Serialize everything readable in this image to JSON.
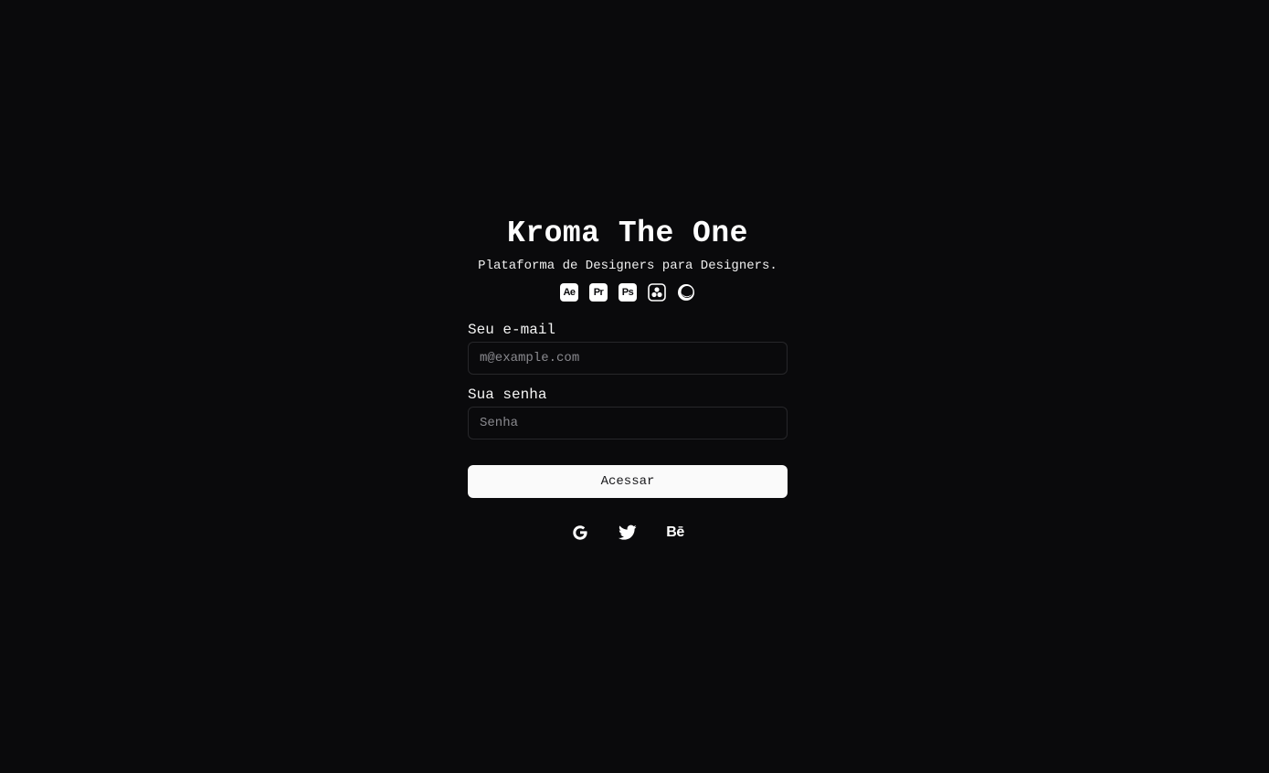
{
  "header": {
    "title": "Kroma The One",
    "subtitle": "Plataforma de Designers para Designers."
  },
  "app_icons": [
    {
      "name": "after-effects-icon",
      "label": "Ae"
    },
    {
      "name": "premiere-icon",
      "label": "Pr"
    },
    {
      "name": "photoshop-icon",
      "label": "Ps"
    },
    {
      "name": "davinci-resolve-icon",
      "label": ""
    },
    {
      "name": "cinema4d-icon",
      "label": ""
    }
  ],
  "form": {
    "email_label": "Seu e-mail",
    "email_placeholder": "m@example.com",
    "email_value": "",
    "password_label": "Sua senha",
    "password_placeholder": "Senha",
    "password_value": "",
    "submit_label": "Acessar"
  },
  "social": [
    {
      "name": "google-icon"
    },
    {
      "name": "twitter-icon"
    },
    {
      "name": "behance-icon",
      "label": "Bē"
    }
  ],
  "colors": {
    "background": "#0a0a0c",
    "text": "#f5f5f5",
    "input_border": "#27272a",
    "button_bg": "#fafafa",
    "button_text": "#18181b"
  }
}
